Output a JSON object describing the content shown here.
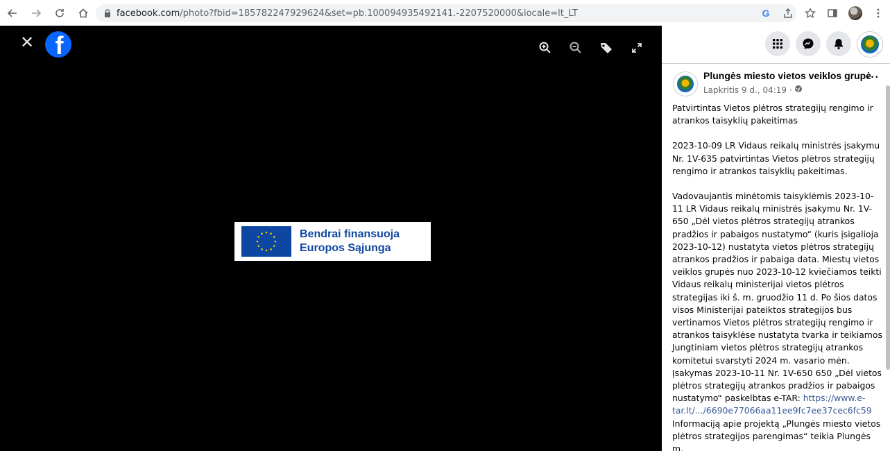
{
  "browser": {
    "url_host": "facebook.com",
    "url_path": "/photo?fbid=185782247929624&set=pb.100094935492141.-2207520000&locale=lt_LT"
  },
  "viewer": {
    "banner_line1": "Bendrai finansuoja",
    "banner_line2": "Europos Sąjunga"
  },
  "post": {
    "page_name": "Plungės miesto vietos veiklos grupė",
    "timestamp": "Lapkritis 9 d., 04:19 ·",
    "paragraph1": "Patvirtintas Vietos plėtros strategijų rengimo ir atrankos taisyklių pakeitimas",
    "paragraph2": "2023-10-09 LR Vidaus reikalų ministrės įsakymu Nr. 1V-635 patvirtintas Vietos plėtros strategijų rengimo ir atrankos taisyklių pakeitimas.",
    "paragraph3": "Vadovaujantis minėtomis taisyklėmis 2023-10-11 LR Vidaus reikalų ministrės įsakymu Nr. 1V-650 „Dėl vietos plėtros strategijų atrankos pradžios ir pabaigos nustatymo“ (kuris įsigalioja 2023-10-12) nustatyta vietos plėtros strategijų atrankos pradžios ir pabaiga data. Miestų vietos veiklos grupės nuo 2023-10-12 kviečiamos teikti Vidaus reikalų ministerijai vietos plėtros strategijas iki š. m. gruodžio 11 d. Po šios datos visos Ministerijai pateiktos strategijos bus vertinamos Vietos plėtros strategijų rengimo ir atrankos taisyklėse nustatyta tvarka ir teikiamos Jungtiniam vietos plėtros strategijų atrankos komitetui svarstyti 2024 m. vasario mėn.",
    "paragraph4_text": "Įsakymas 2023-10-11 Nr. 1V-650 650 „Dėl vietos plėtros strategijų atrankos pradžios ir pabaigos nustatymo“ paskelbtas e-TAR: ",
    "paragraph4_link": "https://www.e-tar.lt/.../6690e77066aa11ee9fc7ee37cec6fc59",
    "paragraph5": "Informaciją apie projektą „Plungės miesto vietos plėtros strategijos parengimas“ teikia Plungės m."
  },
  "colors": {
    "facebook_blue": "#0866ff",
    "eu_blue": "#0e47a1",
    "link": "#385898"
  }
}
